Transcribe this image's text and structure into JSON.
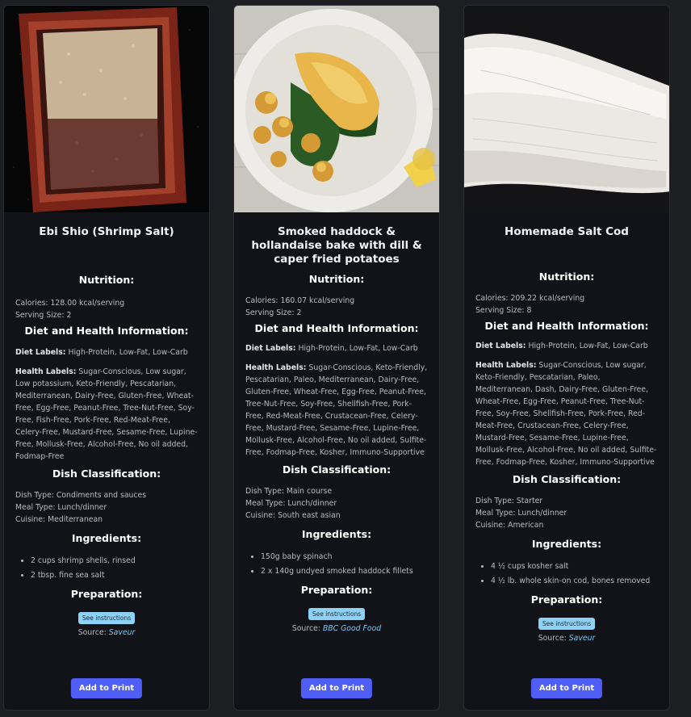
{
  "cards": [
    {
      "image_alt": "Shrimp salt in a red ceramic tray",
      "title": "Ebi Shio (Shrimp Salt)",
      "nutrition_heading": "Nutrition:",
      "calories": "Calories: 128.00 kcal/serving",
      "serving": "Serving Size: 2",
      "diet_heading": "Diet and Health Information:",
      "diet_labels_key": "Diet Labels:",
      "diet_labels": "High-Protein, Low-Fat, Low-Carb",
      "health_labels_key": "Health Labels:",
      "health_labels": "Sugar-Conscious, Low sugar, Low potassium, Keto-Friendly, Pescatarian, Mediterranean, Dairy-Free, Gluten-Free, Wheat-Free, Egg-Free, Peanut-Free, Tree-Nut-Free, Soy-Free, Fish-Free, Pork-Free, Red-Meat-Free, Celery-Free, Mustard-Free, Sesame-Free, Lupine-Free, Mollusk-Free, Alcohol-Free, No oil added, Fodmap-Free",
      "dish_heading": "Dish Classification:",
      "dish_type": "Dish Type: Condiments and sauces",
      "meal_type": "Meal Type: Lunch/dinner",
      "cuisine": "Cuisine: Mediterranean",
      "ingredients_heading": "Ingredients:",
      "ingredients": [
        "2 cups shrimp shells, rinsed",
        "2 tbsp. fine sea salt"
      ],
      "prep_heading": "Preparation:",
      "instructions_label": "See instructions",
      "source_label": "Source:",
      "source": "Saveur",
      "print_label": "Add to Print"
    },
    {
      "image_alt": "Smoked haddock bake on a white plate with potatoes and lemon",
      "title": "Smoked haddock & hollandaise bake with dill & caper fried potatoes",
      "nutrition_heading": "Nutrition:",
      "calories": "Calories: 160.07 kcal/serving",
      "serving": "Serving Size: 2",
      "diet_heading": "Diet and Health Information:",
      "diet_labels_key": "Diet Labels:",
      "diet_labels": "High-Protein, Low-Fat, Low-Carb",
      "health_labels_key": "Health Labels:",
      "health_labels": "Sugar-Conscious, Keto-Friendly, Pescatarian, Paleo, Mediterranean, Dairy-Free, Gluten-Free, Wheat-Free, Egg-Free, Peanut-Free, Tree-Nut-Free, Soy-Free, Shellfish-Free, Pork-Free, Red-Meat-Free, Crustacean-Free, Celery-Free, Mustard-Free, Sesame-Free, Lupine-Free, Mollusk-Free, Alcohol-Free, No oil added, Sulfite-Free, Fodmap-Free, Kosher, Immuno-Supportive",
      "dish_heading": "Dish Classification:",
      "dish_type": "Dish Type: Main course",
      "meal_type": "Meal Type: Lunch/dinner",
      "cuisine": "Cuisine: South east asian",
      "ingredients_heading": "Ingredients:",
      "ingredients": [
        "150g baby spinach",
        "2 x 140g undyed smoked haddock fillets"
      ],
      "prep_heading": "Preparation:",
      "instructions_label": "See instructions",
      "source_label": "Source:",
      "source": "BBC Good Food",
      "print_label": "Add to Print"
    },
    {
      "image_alt": "Raw white cod fillet on dark background",
      "title": "Homemade Salt Cod",
      "nutrition_heading": "Nutrition:",
      "calories": "Calories: 209.22 kcal/serving",
      "serving": "Serving Size: 8",
      "diet_heading": "Diet and Health Information:",
      "diet_labels_key": "Diet Labels:",
      "diet_labels": "High-Protein, Low-Fat, Low-Carb",
      "health_labels_key": "Health Labels:",
      "health_labels": "Sugar-Conscious, Low sugar, Keto-Friendly, Pescatarian, Paleo, Mediterranean, Dash, Dairy-Free, Gluten-Free, Wheat-Free, Egg-Free, Peanut-Free, Tree-Nut-Free, Soy-Free, Shellfish-Free, Pork-Free, Red-Meat-Free, Crustacean-Free, Celery-Free, Mustard-Free, Sesame-Free, Lupine-Free, Mollusk-Free, Alcohol-Free, No oil added, Sulfite-Free, Fodmap-Free, Kosher, Immuno-Supportive",
      "dish_heading": "Dish Classification:",
      "dish_type": "Dish Type: Starter",
      "meal_type": "Meal Type: Lunch/dinner",
      "cuisine": "Cuisine: American",
      "ingredients_heading": "Ingredients:",
      "ingredients": [
        "4 ½ cups kosher salt",
        "4 ½ lb. whole skin-on cod, bones removed"
      ],
      "prep_heading": "Preparation:",
      "instructions_label": "See instructions",
      "source_label": "Source:",
      "source": "Saveur",
      "print_label": "Add to Print"
    }
  ],
  "colors": {
    "page_bg": "#1d1e22",
    "card_bg": "#121318",
    "button": "#4f5ef5",
    "instructions_chip": "#8ed1f5",
    "link": "#7fc8f2"
  }
}
